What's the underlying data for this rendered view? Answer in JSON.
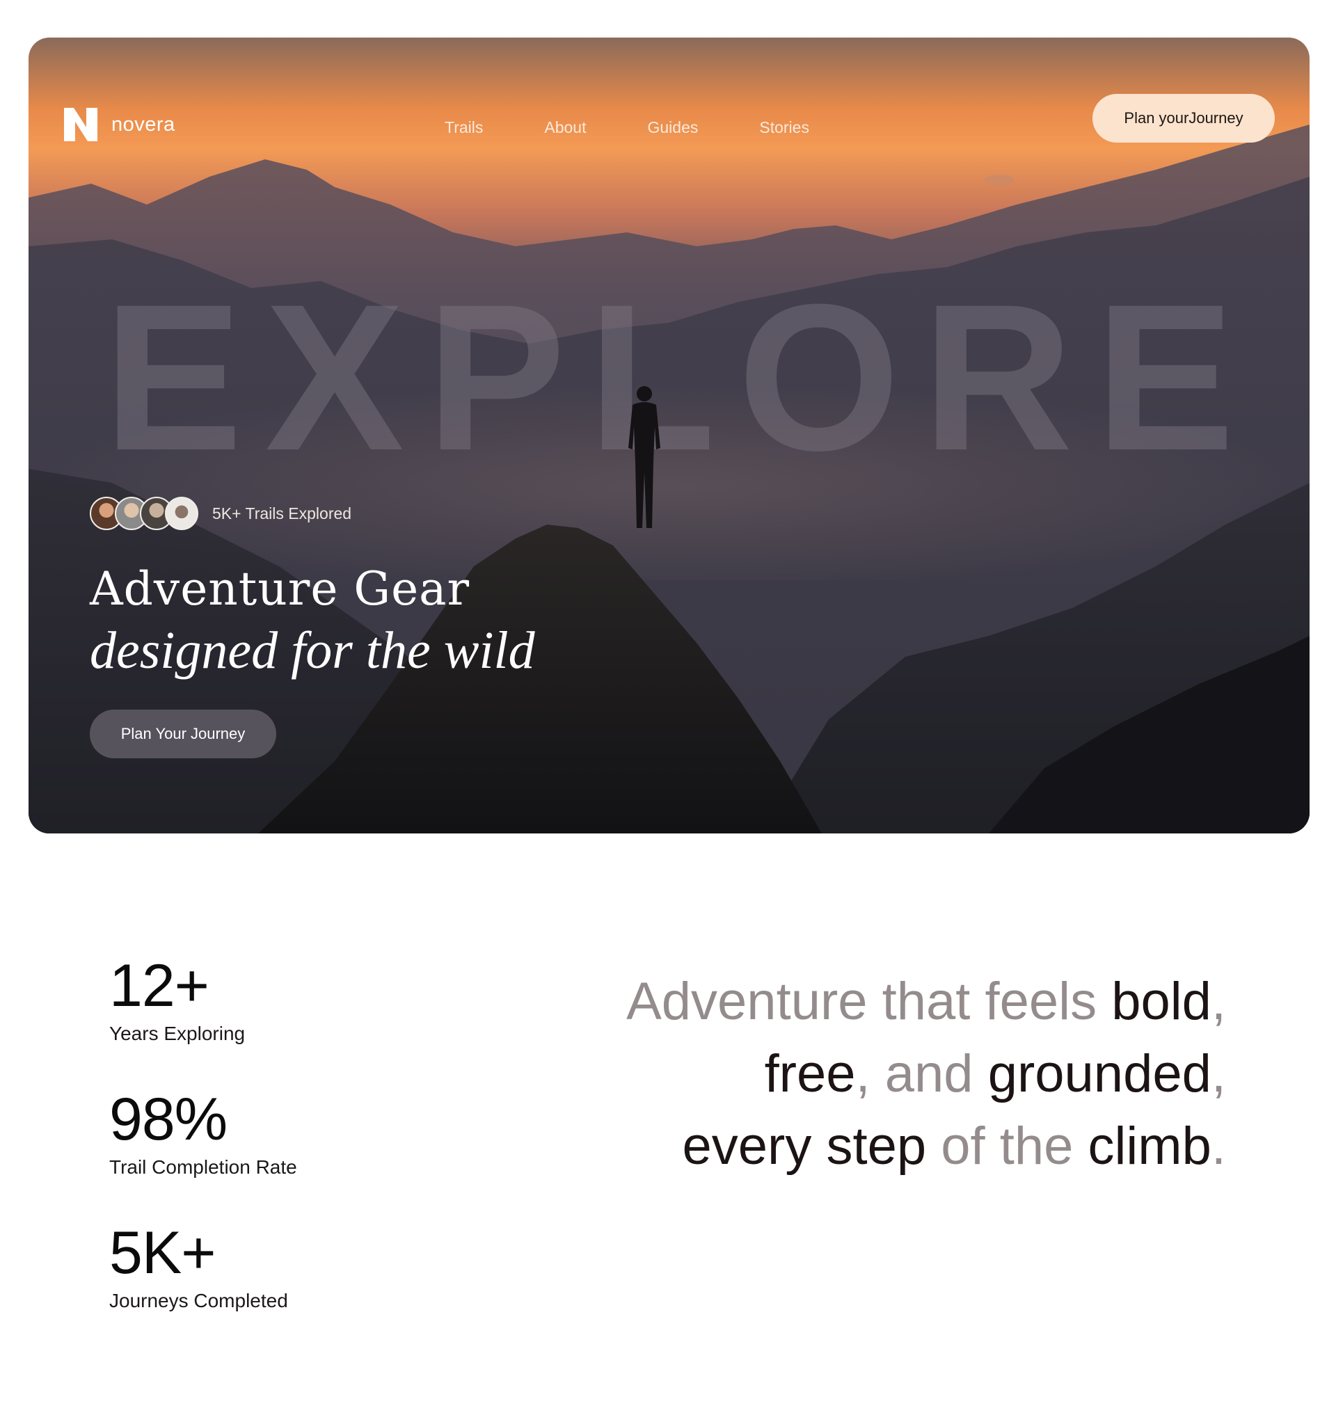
{
  "brand": {
    "name": "novera",
    "mark": "N"
  },
  "nav": {
    "links": [
      "Trails",
      "About",
      "Guides",
      "Stories"
    ],
    "cta": "Plan yourJourney"
  },
  "hero": {
    "watermark": "EXPLORE",
    "proof_text": "5K+ Trails Explored",
    "headline_line1": "Adventure Gear",
    "headline_line2": "designed for the wild",
    "cta": "Plan Your Journey"
  },
  "stats": [
    {
      "value": "12+",
      "label": "Years Exploring"
    },
    {
      "value": "98%",
      "label": "Trail Completion Rate"
    },
    {
      "value": "5K+",
      "label": "Journeys Completed"
    }
  ],
  "tagline": {
    "lines": [
      [
        {
          "text": "Adventure that feels ",
          "emphasis": false
        },
        {
          "text": "bold",
          "emphasis": true
        },
        {
          "text": ",",
          "emphasis": false
        }
      ],
      [
        {
          "text": "free",
          "emphasis": true
        },
        {
          "text": ", and ",
          "emphasis": false
        },
        {
          "text": "grounded",
          "emphasis": true
        },
        {
          "text": ",",
          "emphasis": false
        }
      ],
      [
        {
          "text": "every step ",
          "emphasis": true
        },
        {
          "text": "of the ",
          "emphasis": false
        },
        {
          "text": "climb",
          "emphasis": true
        },
        {
          "text": ".",
          "emphasis": false
        }
      ]
    ]
  },
  "colors": {
    "accent_button": "#fbe3cd",
    "text_dark": "#1c1414",
    "text_dim": "#948c8c"
  }
}
